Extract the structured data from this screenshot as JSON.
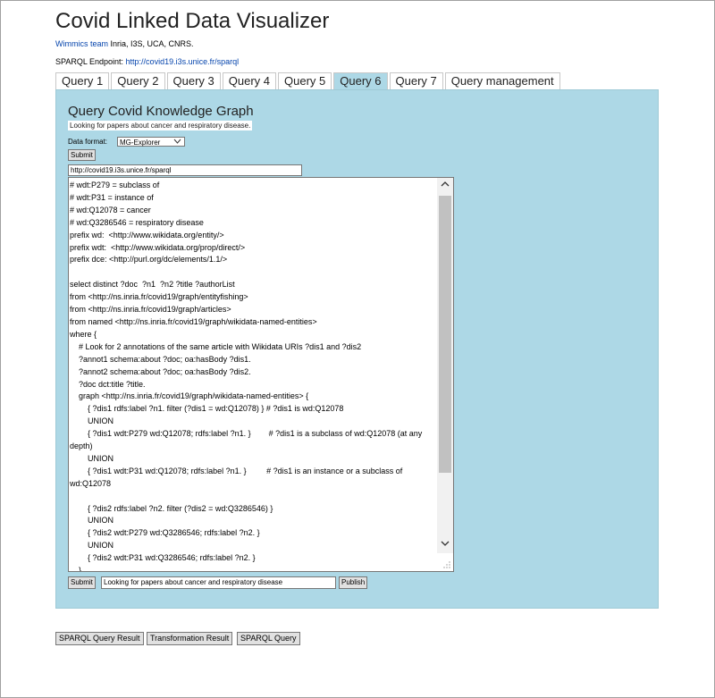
{
  "page": {
    "title": "Covid Linked Data Visualizer",
    "team_link": "Wimmics team",
    "team_rest": " Inria, I3S, UCA, CNRS.",
    "endpoint_label": "SPARQL Endpoint: ",
    "endpoint_link": "http://covid19.i3s.unice.fr/sparql"
  },
  "tabs": [
    {
      "label": "Query 1",
      "active": false
    },
    {
      "label": "Query 2",
      "active": false
    },
    {
      "label": "Query 3",
      "active": false
    },
    {
      "label": "Query 4",
      "active": false
    },
    {
      "label": "Query 5",
      "active": false
    },
    {
      "label": "Query 6",
      "active": true
    },
    {
      "label": "Query 7",
      "active": false
    },
    {
      "label": "Query management",
      "active": false
    }
  ],
  "panel": {
    "title": "Query Covid Knowledge Graph",
    "description": "Looking for papers about cancer and respiratory disease.",
    "format_label": "Data format:",
    "format_value": "MG-Explorer",
    "submit_label": "Submit",
    "endpoint_value": "http://covid19.i3s.unice.fr/sparql",
    "query_text": "# wdt:P279 = subclass of\n# wdt:P31 = instance of\n# wd:Q12078 = cancer\n# wd:Q3286546 = respiratory disease\nprefix wd:  <http://www.wikidata.org/entity/>\nprefix wdt:  <http://www.wikidata.org/prop/direct/>\nprefix dce: <http://purl.org/dc/elements/1.1/>\n\nselect distinct ?doc  ?n1  ?n2 ?title ?authorList\nfrom <http://ns.inria.fr/covid19/graph/entityfishing>\nfrom <http://ns.inria.fr/covid19/graph/articles>\nfrom named <http://ns.inria.fr/covid19/graph/wikidata-named-entities>\nwhere {\n    # Look for 2 annotations of the same article with Wikidata URIs ?dis1 and ?dis2\n    ?annot1 schema:about ?doc; oa:hasBody ?dis1.\n    ?annot2 schema:about ?doc; oa:hasBody ?dis2.\n    ?doc dct:title ?title.\n    graph <http://ns.inria.fr/covid19/graph/wikidata-named-entities> {\n        { ?dis1 rdfs:label ?n1. filter (?dis1 = wd:Q12078) } # ?dis1 is wd:Q12078\n        UNION\n        { ?dis1 wdt:P279 wd:Q12078; rdfs:label ?n1. }        # ?dis1 is a subclass of wd:Q12078 (at any depth)\n        UNION\n        { ?dis1 wdt:P31 wd:Q12078; rdfs:label ?n1. }         # ?dis1 is an instance or a subclass of wd:Q12078\n\n        { ?dis2 rdfs:label ?n2. filter (?dis2 = wd:Q3286546) }\n        UNION\n        { ?dis2 wdt:P279 wd:Q3286546; rdfs:label ?n2. }\n        UNION\n        { ?dis2 wdt:P31 wd:Q3286546; rdfs:label ?n2. }\n    }",
    "submit2_label": "Submit",
    "desc_input_value": "Looking for papers about cancer and respiratory disease",
    "publish_label": "Publish"
  },
  "bottom_buttons": {
    "sparql_result": "SPARQL Query Result",
    "transformation_result": "Transformation Result",
    "sparql_query": "SPARQL Query"
  },
  "icons": {
    "dropdown": "chevron-down-icon",
    "scroll_up": "chevron-up-icon",
    "scroll_down": "chevron-down-icon",
    "resize": "resize-grip-icon"
  },
  "colors": {
    "panel_bg": "#add8e6",
    "link": "#0645ad",
    "button_bg": "#e1e1e1"
  }
}
